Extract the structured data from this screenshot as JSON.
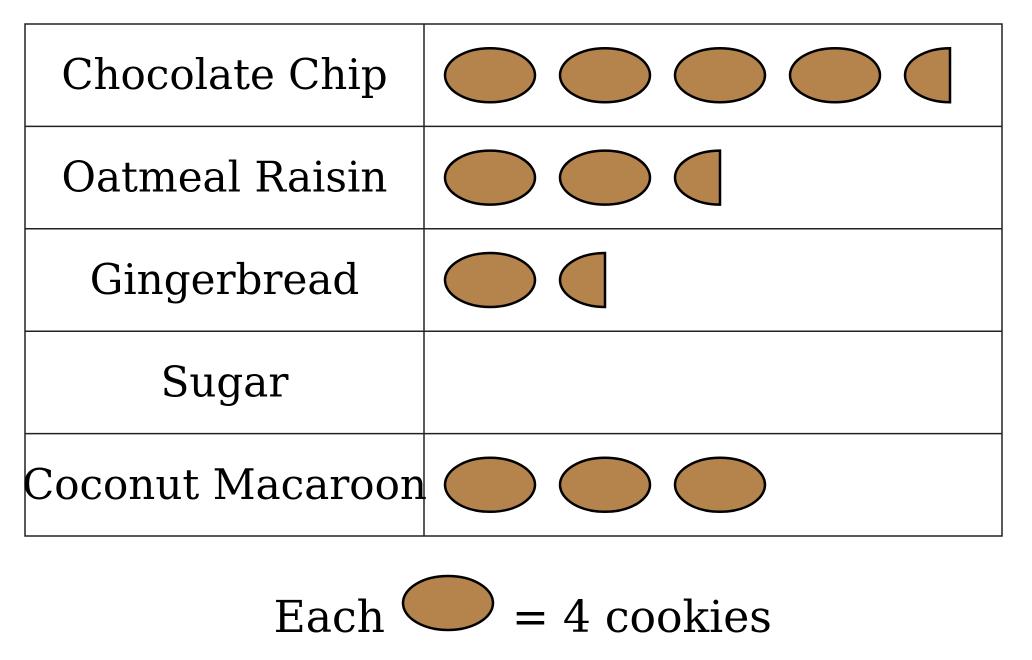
{
  "chart_data": {
    "type": "pictograph",
    "categories": [
      "Chocolate Chip",
      "Oatmeal Raisin",
      "Gingerbread",
      "Sugar",
      "Coconut Macaroon"
    ],
    "icon": "cookie-icon",
    "icons_per_row": [
      4.5,
      2.5,
      1.5,
      0,
      3
    ],
    "values": [
      18,
      10,
      6,
      0,
      12
    ],
    "unit_value": 4,
    "key": {
      "prefix": "Each",
      "suffix": "= 4 cookies"
    },
    "colors": {
      "cookie_fill": "#b5834c",
      "outline": "#000000",
      "grid": "#222222"
    }
  }
}
